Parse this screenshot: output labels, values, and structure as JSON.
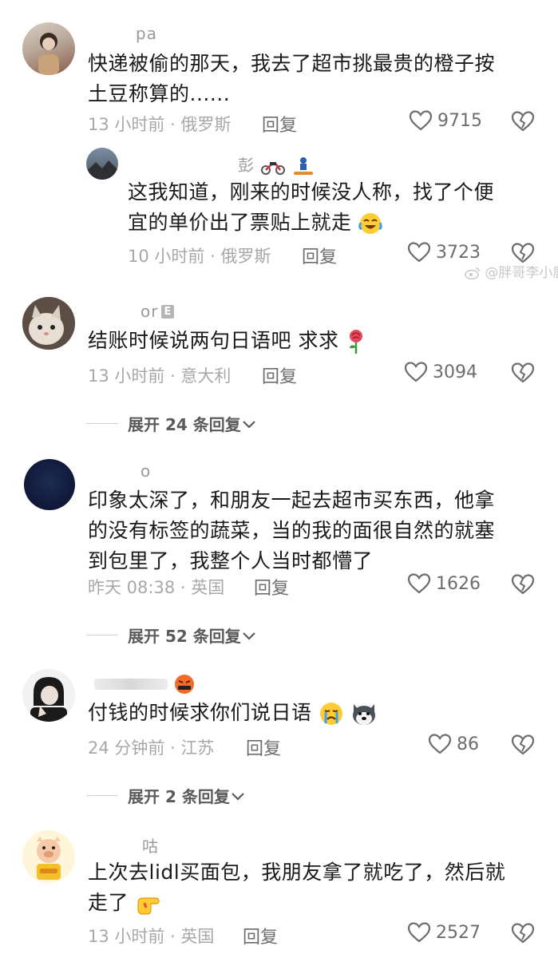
{
  "comments": [
    {
      "name": "pa",
      "text_line1": "快递被偷的那天，我去了超市挑最贵的橙子按",
      "text_line2": "土豆称算的......",
      "meta": "13 小时前 · 俄罗斯",
      "reply": "回复",
      "likes": "9715"
    },
    {
      "name": "彭",
      "text_line1": "这我知道，刚来的时候没人称，找了个便",
      "text_line2": "宜的单价出了票贴上就走",
      "meta": "10 小时前 · 俄罗斯",
      "reply": "回复",
      "likes": "3723"
    },
    {
      "name": "or",
      "name_badge": "E",
      "text_line1": "结账时候说两句日语吧 求求",
      "meta": "13 小时前 · 意大利",
      "reply": "回复",
      "likes": "3094",
      "expand": "展开 24 条回复"
    },
    {
      "name": "o",
      "text_line1": "印象太深了，和朋友一起去超市买东西，他拿",
      "text_line2": "的没有标签的蔬菜，当的我的面很自然的就塞",
      "text_line3": "到包里了，我整个人当时都懵了",
      "meta": "昨天 08:38 · 英国",
      "reply": "回复",
      "likes": "1626",
      "expand": "展开 52 条回复"
    },
    {
      "name": "",
      "text_line1": "付钱的时候求你们说日语",
      "meta": "24 分钟前 · 江苏",
      "reply": "回复",
      "likes": "86",
      "expand": "展开 2 条回复"
    },
    {
      "name": "咕",
      "text_line1": "上次去lidl买面包，我朋友拿了就吃了，然后就",
      "text_line2": "走了",
      "meta": "13 小时前 · 英国",
      "reply": "回复",
      "likes": "2527"
    }
  ],
  "watermark": "@胖哥李小鹿",
  "colors": {
    "text": "#1a1a1a",
    "meta": "#a8a8a8",
    "icon": "#6d6d6d"
  }
}
